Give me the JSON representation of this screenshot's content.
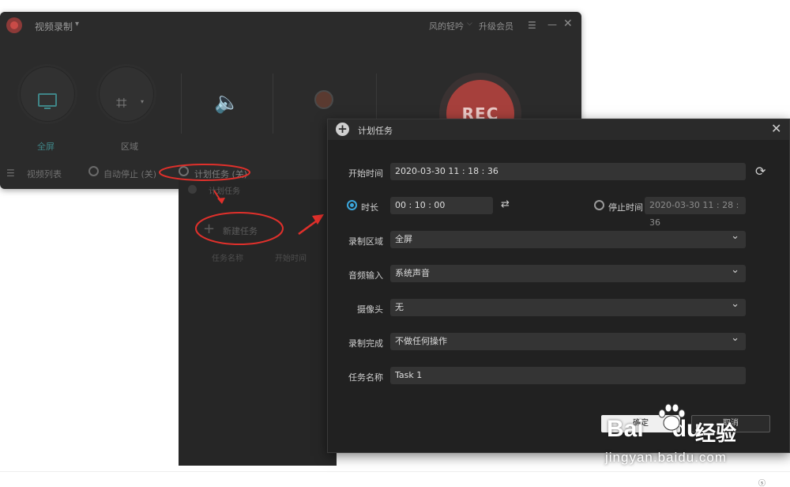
{
  "main_window": {
    "title": "视频录制",
    "title_chevron": "▾",
    "user_name": "风的轻吟",
    "user_chevron": "⌵",
    "upgrade_label": "升级会员",
    "menu_icon": "☰",
    "min_icon": "—",
    "close_icon": "✕",
    "modes": [
      {
        "label": "全屏",
        "icon": "monitor-icon",
        "active": true
      },
      {
        "label": "区域",
        "icon": "crop-icon",
        "active": false
      }
    ],
    "region_glyph": "⌗",
    "region_chevron": "▾",
    "audio_icon": "speaker-icon",
    "speaker_glyph": "🔈",
    "webcam_icon": "webcam-icon",
    "rec_label": "REC",
    "bottom": {
      "list_glyph": "☰",
      "video_list": "视频列表",
      "auto_stop": "自动停止 (关)",
      "schedule": "计划任务 (关)"
    },
    "accent_color": "#3f8587",
    "rec_color": "#a6403c"
  },
  "task_panel": {
    "heading": "计划任务",
    "new_task_glyph": "+",
    "new_task": "新建任务",
    "columns": [
      "任务名称",
      "开始时间"
    ]
  },
  "dialog": {
    "title": "计划任务",
    "plus_glyph": "+",
    "close_glyph": "✕",
    "start_time_label": "开始时间",
    "start_time": "2020-03-30 11 : 18 : 36",
    "refresh_glyph": "⟳",
    "duration_label": "时长",
    "duration": "00 : 10 : 00",
    "duration_selected": true,
    "swap_glyph": "⇄",
    "stop_time_label": "停止时间",
    "stop_time": "2020-03-30 11 : 28 : 36",
    "region_label": "录制区域",
    "region_value": "全屏",
    "audio_label": "音频输入",
    "audio_value": "系统声音",
    "camera_label": "摄像头",
    "camera_value": "无",
    "done_label": "录制完成",
    "done_value": "不做任何操作",
    "task_name_label": "任务名称",
    "task_name": "Task 1",
    "ok_label": "确定",
    "cancel_label": "取消",
    "radio_color": "#3ba6dc"
  },
  "annotation_color": "#e0302b",
  "watermark": {
    "brand": "Bai",
    "brand_tail": "du",
    "jingyan": "经验",
    "url": "jingyan.baidu.com"
  },
  "corner_glyph": "ⓢ"
}
